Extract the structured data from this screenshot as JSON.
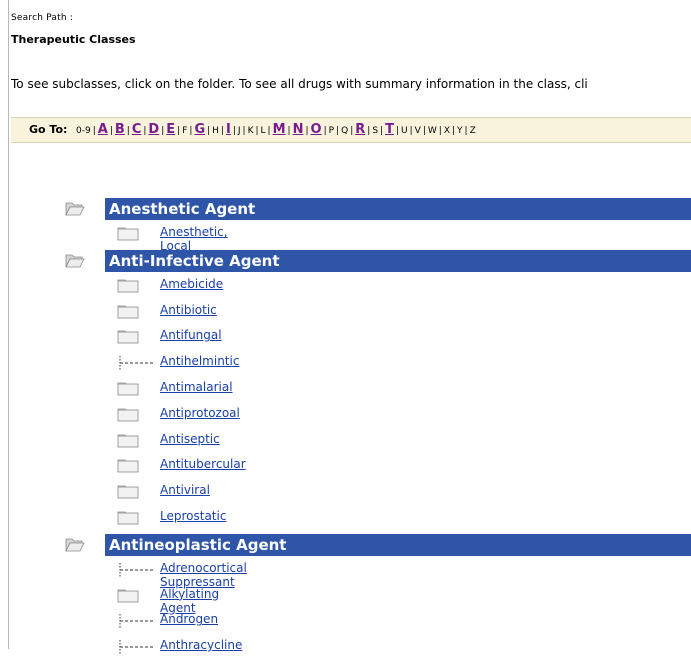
{
  "search_path": {
    "label": "Search Path :",
    "value": "Therapeutic Classes"
  },
  "instructions": "To see subclasses, click on the folder. To see all drugs with summary information in the class, cli",
  "goto": {
    "label": "Go To:",
    "letters": [
      {
        "t": "0-9",
        "active": false
      },
      {
        "t": "A",
        "active": true
      },
      {
        "t": "B",
        "active": true
      },
      {
        "t": "C",
        "active": true
      },
      {
        "t": "D",
        "active": true
      },
      {
        "t": "E",
        "active": true
      },
      {
        "t": "F",
        "active": false
      },
      {
        "t": "G",
        "active": true
      },
      {
        "t": "H",
        "active": false
      },
      {
        "t": "I",
        "active": true
      },
      {
        "t": "J",
        "active": false
      },
      {
        "t": "K",
        "active": false
      },
      {
        "t": "L",
        "active": false
      },
      {
        "t": "M",
        "active": true
      },
      {
        "t": "N",
        "active": true
      },
      {
        "t": "O",
        "active": true
      },
      {
        "t": "P",
        "active": false
      },
      {
        "t": "Q",
        "active": false
      },
      {
        "t": "R",
        "active": true
      },
      {
        "t": "S",
        "active": false
      },
      {
        "t": "T",
        "active": true
      },
      {
        "t": "U",
        "active": false
      },
      {
        "t": "V",
        "active": false
      },
      {
        "t": "W",
        "active": false
      },
      {
        "t": "X",
        "active": false
      },
      {
        "t": "Y",
        "active": false
      },
      {
        "t": "Z",
        "active": false
      }
    ]
  },
  "categories": [
    {
      "title": "Anesthetic Agent",
      "items": [
        {
          "label": "Anesthetic, Local",
          "kind": "folder"
        }
      ]
    },
    {
      "title": "Anti-Infective Agent",
      "items": [
        {
          "label": "Amebicide",
          "kind": "folder"
        },
        {
          "label": "Antibiotic",
          "kind": "folder"
        },
        {
          "label": "Antifungal",
          "kind": "folder"
        },
        {
          "label": "Antihelmintic",
          "kind": "leaf"
        },
        {
          "label": "Antimalarial",
          "kind": "folder"
        },
        {
          "label": "Antiprotozoal",
          "kind": "folder"
        },
        {
          "label": "Antiseptic",
          "kind": "folder"
        },
        {
          "label": "Antitubercular",
          "kind": "folder"
        },
        {
          "label": "Antiviral",
          "kind": "folder"
        },
        {
          "label": "Leprostatic",
          "kind": "folder"
        }
      ]
    },
    {
      "title": "Antineoplastic Agent",
      "items": [
        {
          "label": "Adrenocortical Suppressant",
          "kind": "leaf"
        },
        {
          "label": "Alkylating Agent",
          "kind": "folder"
        },
        {
          "label": "Androgen",
          "kind": "leaf"
        },
        {
          "label": "Anthracycline",
          "kind": "leaf"
        }
      ]
    }
  ],
  "colors": {
    "header_bg": "#2e55a8",
    "link": "#1a3fa8",
    "active_letter": "#7b1a8c",
    "goto_bg": "#f7f3dc"
  }
}
